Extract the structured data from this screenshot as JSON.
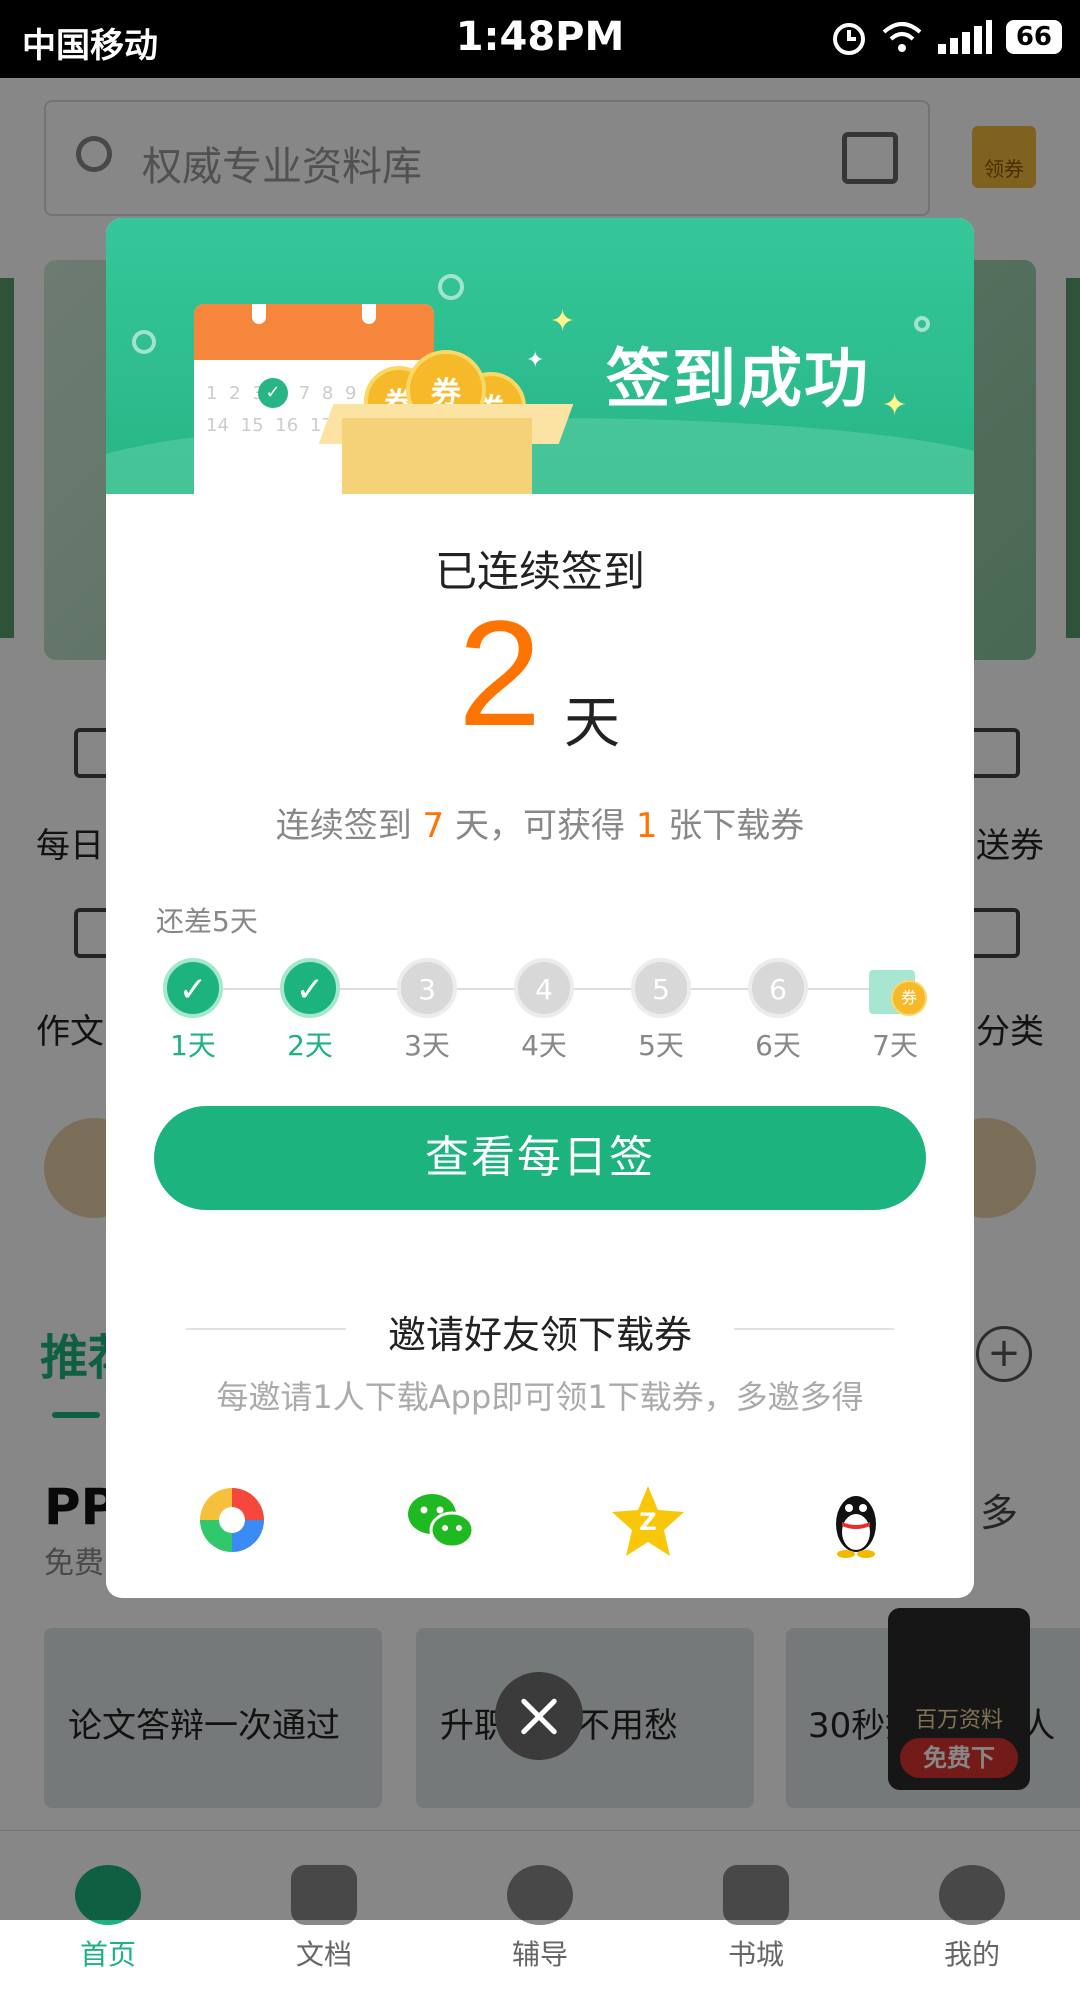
{
  "status_bar": {
    "carrier": "中国移动",
    "time": "1:48PM",
    "battery": "66",
    "icons": [
      "alarm-icon",
      "wifi-icon",
      "signal-icon",
      "battery-icon"
    ]
  },
  "background": {
    "search_placeholder": "权威专业资料库",
    "coupon_label": "领券",
    "left_items": [
      "每日",
      "作文"
    ],
    "right_items": [
      "送券",
      "分类"
    ],
    "recommend_tab": "推荐",
    "ppt_title": "PP",
    "ppt_sub": "免费",
    "more": "多",
    "cards": [
      "论文答辩一次通过",
      "升职加薪不用愁",
      "30秒搞定投资人"
    ],
    "promo_text": "百万资料",
    "promo_button": "免费下"
  },
  "tabbar": {
    "tabs": [
      {
        "label": "首页",
        "icon": "home-icon",
        "active": true
      },
      {
        "label": "文档",
        "icon": "folder-icon",
        "active": false
      },
      {
        "label": "辅导",
        "icon": "tutor-icon",
        "active": false
      },
      {
        "label": "书城",
        "icon": "book-icon",
        "active": false
      },
      {
        "label": "我的",
        "icon": "profile-icon",
        "active": false
      }
    ]
  },
  "dialog": {
    "header_title": "签到成功",
    "calendar_numbers": "1 2 3 4 7 8 9 10 11 14 15 16 17",
    "coin_label": "券",
    "streak_label": "已连续签到",
    "streak_days": "2",
    "streak_unit": "天",
    "reward": {
      "prefix": "连续签到 ",
      "days": "7",
      "middle": " 天，可获得 ",
      "count": "1",
      "suffix": " 张下载券"
    },
    "remaining": "还差5天",
    "days": [
      {
        "num": "1",
        "label": "1天",
        "done": true
      },
      {
        "num": "2",
        "label": "2天",
        "done": true
      },
      {
        "num": "3",
        "label": "3天",
        "done": false
      },
      {
        "num": "4",
        "label": "4天",
        "done": false
      },
      {
        "num": "5",
        "label": "5天",
        "done": false
      },
      {
        "num": "6",
        "label": "6天",
        "done": false
      },
      {
        "num": "7",
        "label": "7天",
        "done": false,
        "gift": true
      }
    ],
    "check_mark": "✓",
    "cta_label": "查看每日签",
    "invite_title": "邀请好友领下载券",
    "invite_desc": "每邀请1人下载App即可领1下载券，多邀多得",
    "share_targets": [
      "moments-icon",
      "wechat-icon",
      "qzone-icon",
      "qq-icon"
    ]
  },
  "colors": {
    "accent": "#1db37e",
    "highlight": "#ff7300",
    "header": "#27b585"
  }
}
